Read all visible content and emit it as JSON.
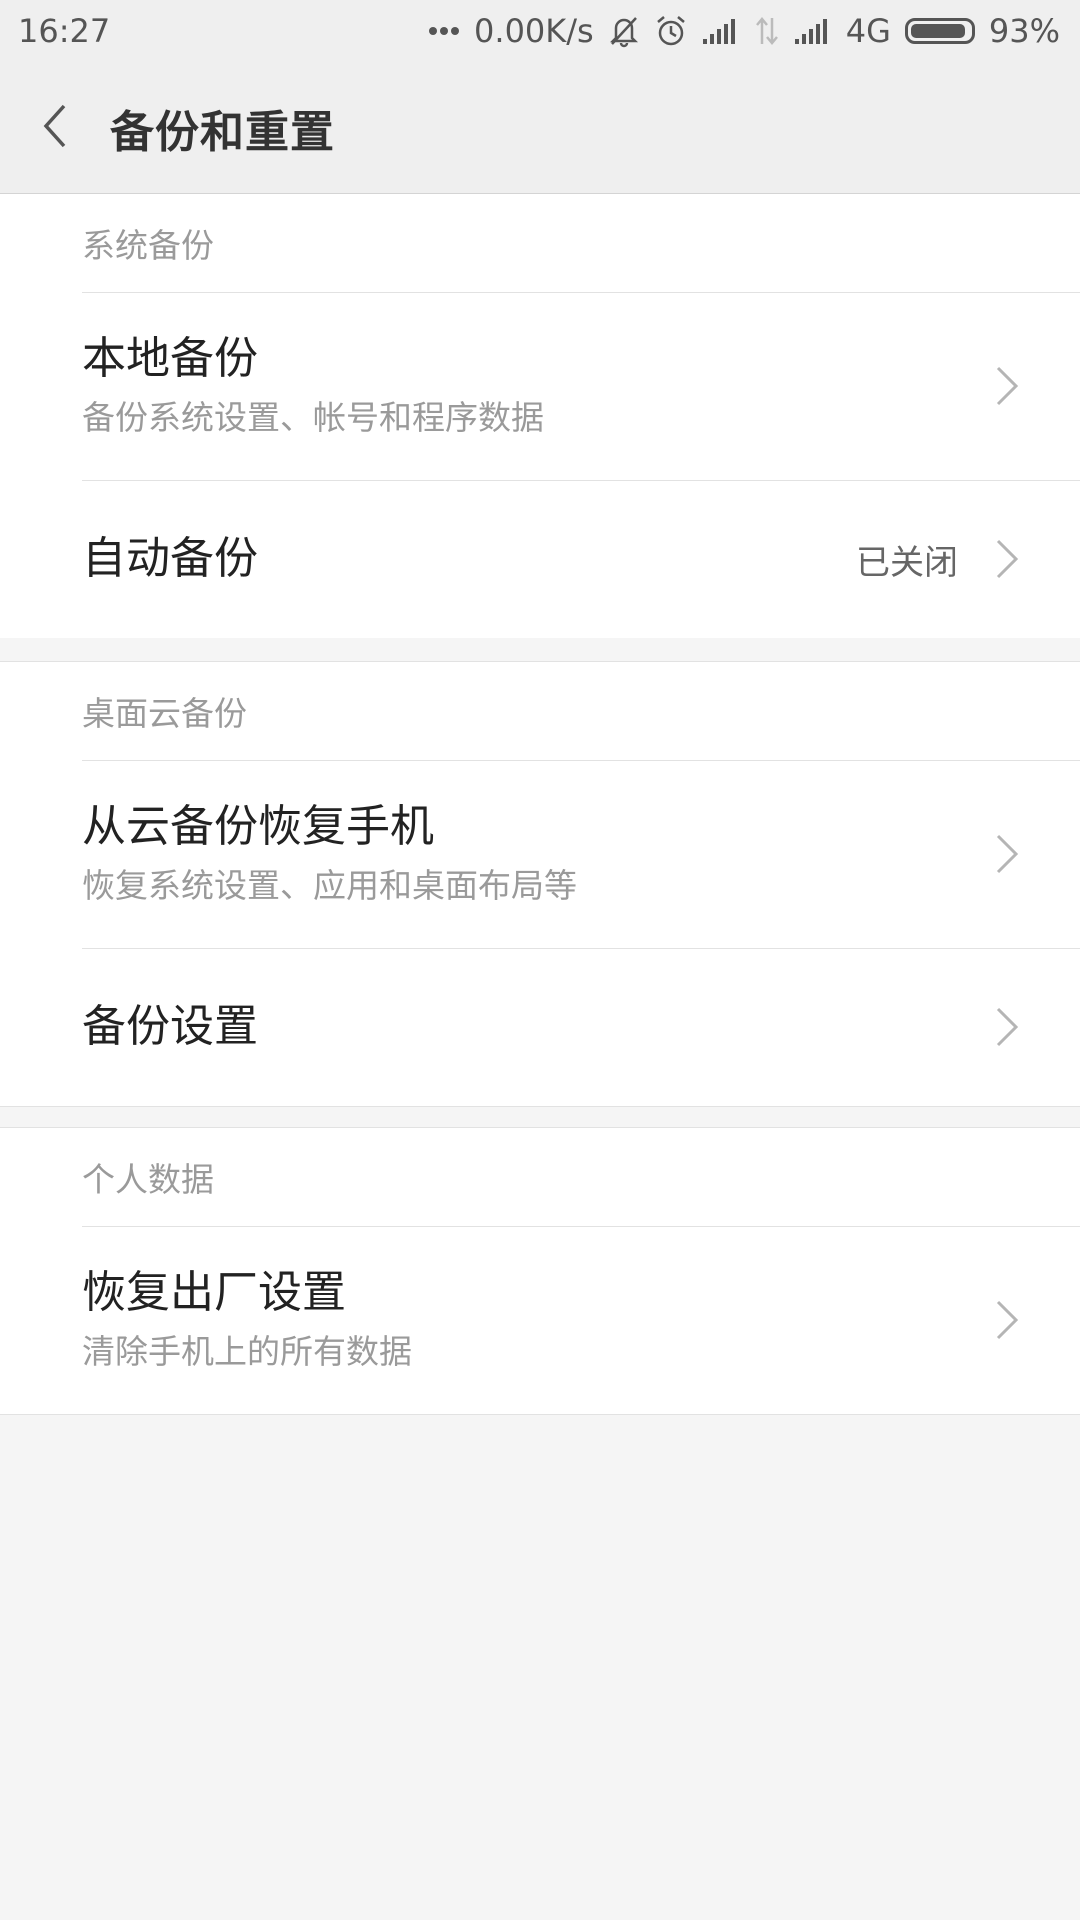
{
  "status_bar": {
    "time": "16:27",
    "network_speed": "0.00K/s",
    "network_type": "4G",
    "battery_percent": "93%",
    "battery_level": 0.93,
    "icons": [
      "more-dots-icon",
      "bell-muted-icon",
      "alarm-icon",
      "signal-icon",
      "data-arrows-icon",
      "signal-icon",
      "battery-icon"
    ]
  },
  "header": {
    "title": "备份和重置",
    "back_icon": "chevron-left-icon"
  },
  "sections": [
    {
      "title": "系统备份",
      "items": [
        {
          "title": "本地备份",
          "subtitle": "备份系统设置、帐号和程序数据"
        },
        {
          "title": "自动备份",
          "value": "已关闭"
        }
      ]
    },
    {
      "title": "桌面云备份",
      "items": [
        {
          "title": "从云备份恢复手机",
          "subtitle": "恢复系统设置、应用和桌面布局等"
        },
        {
          "title": "备份设置"
        }
      ]
    },
    {
      "title": "个人数据",
      "items": [
        {
          "title": "恢复出厂设置",
          "subtitle": "清除手机上的所有数据"
        }
      ]
    }
  ],
  "colors": {
    "background": "#f5f5f5",
    "header_bg": "#efefef",
    "card_bg": "#ffffff",
    "primary_text": "#222222",
    "secondary_text": "#9a9a9a",
    "divider": "#e2e2e2"
  }
}
